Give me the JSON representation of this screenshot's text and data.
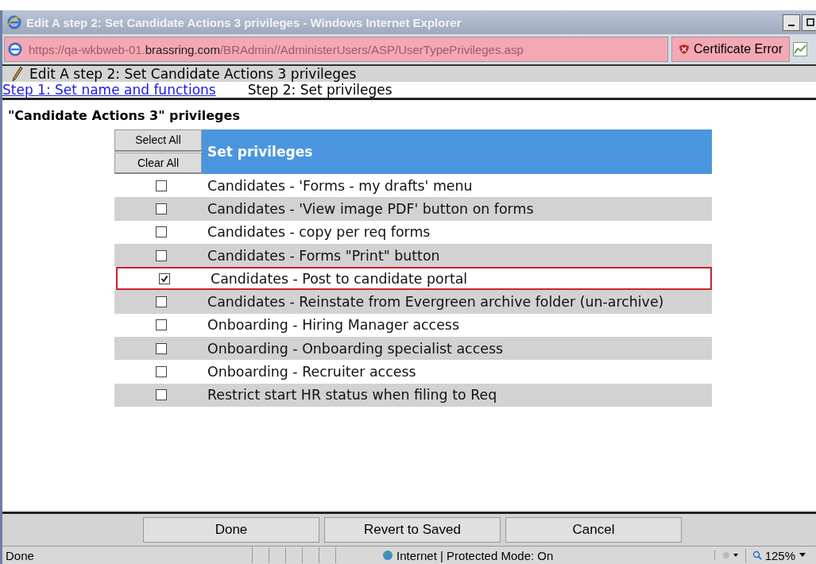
{
  "window": {
    "title": "Edit A step 2: Set Candidate Actions 3 privileges - Windows Internet Explorer"
  },
  "address_bar": {
    "url_prefix": "https://qa-wkbweb-01.",
    "url_domain": "brassring.com",
    "url_path": "/BRAdmin//AdministerUsers/ASP/UserTypePrivileges.asp",
    "certificate": "Certificate Error"
  },
  "page_header": {
    "title": "Edit A step 2: Set Candidate Actions 3 privileges"
  },
  "steps": [
    {
      "label": "Step 1: Set name and functions",
      "kind": "link"
    },
    {
      "label": "Step 2: Set privileges",
      "kind": "current"
    }
  ],
  "heading": "\"Candidate Actions 3\" privileges",
  "table": {
    "select_all": "Select All",
    "clear_all": "Clear All",
    "header": "Set privileges",
    "rows": [
      {
        "label": "Candidates - 'Forms - my drafts' menu",
        "checked": false,
        "selected": false
      },
      {
        "label": "Candidates - 'View image PDF' button on forms",
        "checked": false,
        "selected": false
      },
      {
        "label": "Candidates - copy per req forms",
        "checked": false,
        "selected": false
      },
      {
        "label": "Candidates - Forms \"Print\" button",
        "checked": false,
        "selected": false
      },
      {
        "label": "Candidates - Post to candidate portal",
        "checked": true,
        "selected": true
      },
      {
        "label": "Candidates - Reinstate from Evergreen archive folder (un-archive)",
        "checked": false,
        "selected": false
      },
      {
        "label": "Onboarding - Hiring Manager access",
        "checked": false,
        "selected": false
      },
      {
        "label": "Onboarding - Onboarding specialist access",
        "checked": false,
        "selected": false
      },
      {
        "label": "Onboarding - Recruiter access",
        "checked": false,
        "selected": false
      },
      {
        "label": "Restrict start HR status when filing to Req",
        "checked": false,
        "selected": false
      }
    ]
  },
  "buttons": [
    "Done",
    "Revert to Saved",
    "Cancel"
  ],
  "status_bar": {
    "text": "Done",
    "zone": "Internet | Protected Mode: On",
    "zoom": "125%"
  }
}
